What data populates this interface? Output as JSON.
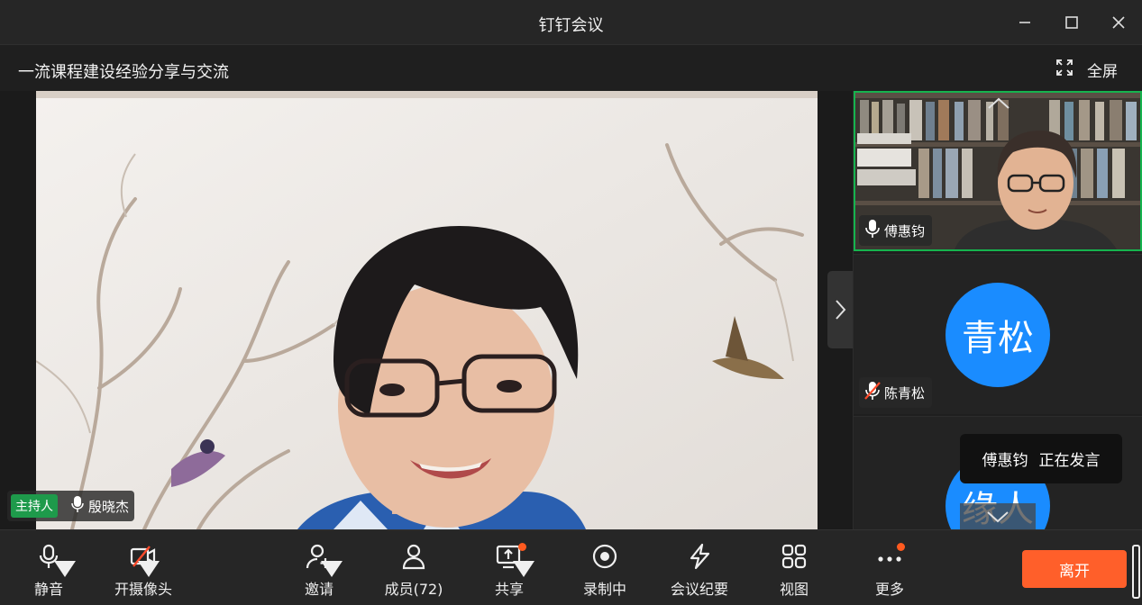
{
  "window": {
    "title": "钉钉会议"
  },
  "meeting": {
    "subject": "一流课程建设经验分享与交流",
    "fullscreen_label": "全屏"
  },
  "main_video": {
    "host_badge": "主持人",
    "speaker_name": "殷晓杰"
  },
  "participants": [
    {
      "name": "傅惠钧",
      "mic": "on"
    },
    {
      "name": "陈青松",
      "avatar_text": "青松",
      "mic": "muted"
    },
    {
      "avatar_text": "缘人"
    }
  ],
  "toast": {
    "name": "傅惠钧",
    "status": "正在发言"
  },
  "toolbar": {
    "mute": "静音",
    "camera": "开摄像头",
    "invite": "邀请",
    "members": "成员(72)",
    "share": "共享",
    "record": "录制中",
    "minutes": "会议纪要",
    "view": "视图",
    "more": "更多",
    "leave": "离开"
  },
  "colors": {
    "accent_green": "#16b34e",
    "avatar_blue": "#1a8cff",
    "leave_orange": "#ff5f2a",
    "notify_dot": "#ff5a1f"
  },
  "icons": [
    "minimize-icon",
    "maximize-icon",
    "close-icon",
    "fullscreen-icon",
    "microphone-icon",
    "mic-muted-icon",
    "camera-off-icon",
    "invite-icon",
    "members-icon",
    "share-screen-icon",
    "record-icon",
    "minutes-icon",
    "grid-view-icon",
    "more-icon",
    "chevron-right-icon",
    "chevron-up-icon",
    "chevron-down-icon"
  ]
}
